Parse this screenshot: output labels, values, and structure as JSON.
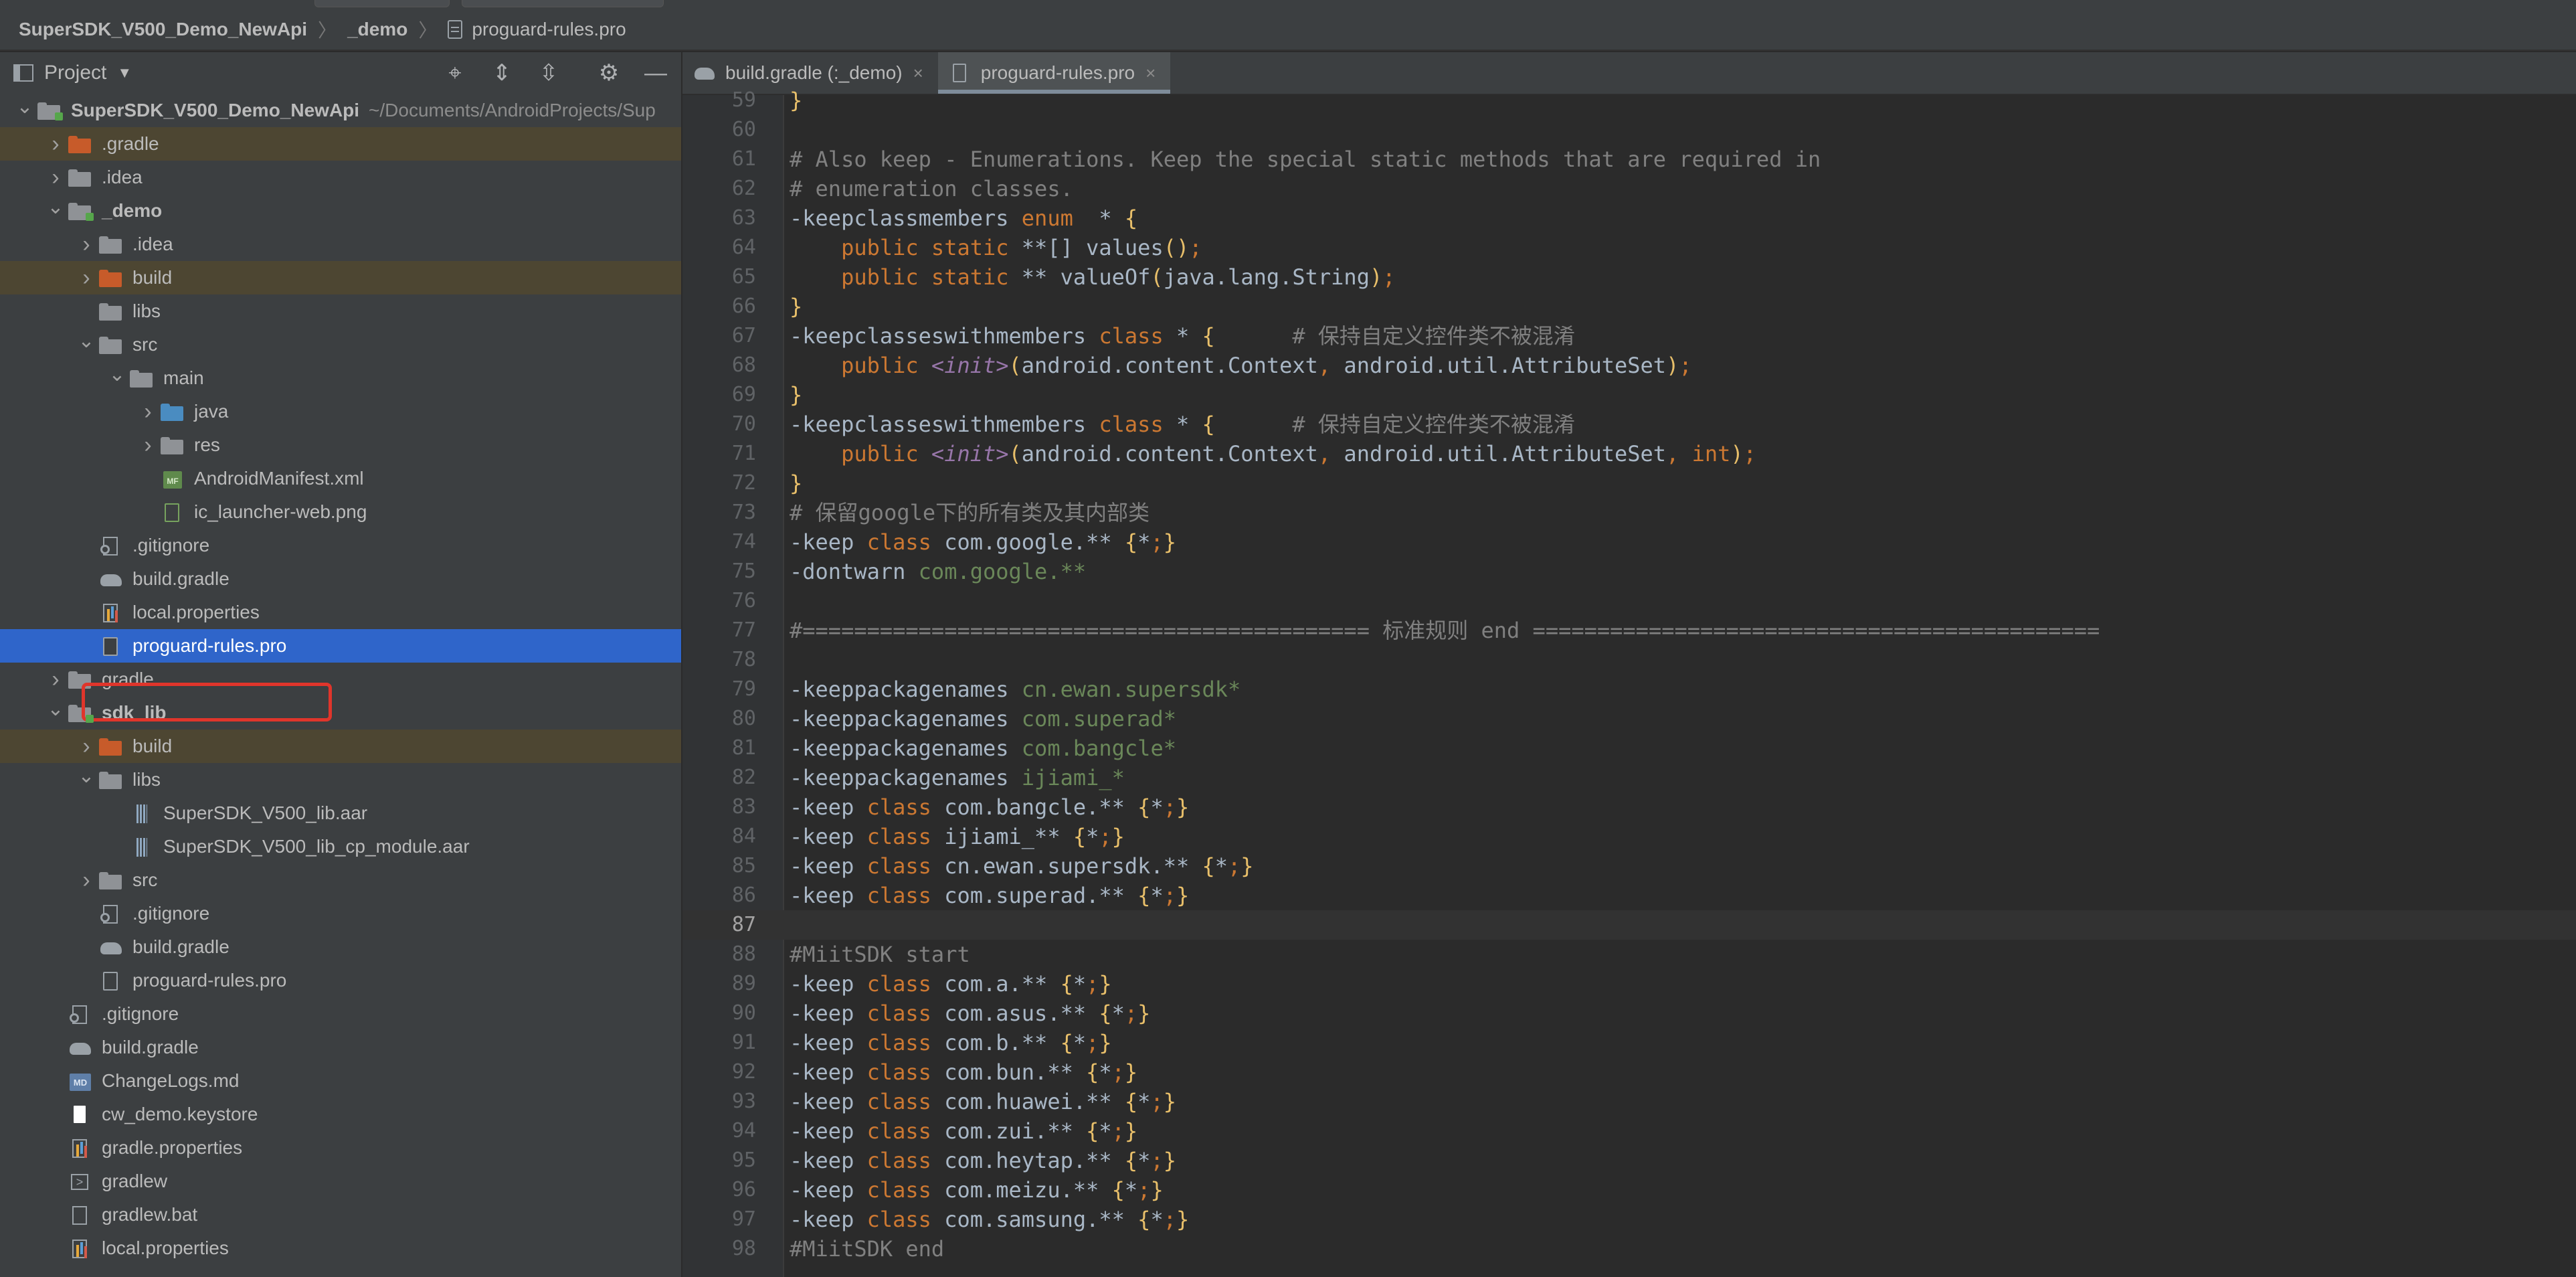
{
  "breadcrumb": {
    "project": "SuperSDK_V500_Demo_NewApi",
    "module": "_demo",
    "file": "proguard-rules.pro"
  },
  "project_panel": {
    "title": "Project",
    "tool_icons": [
      "crosshair-icon",
      "expand-all-icon",
      "collapse-all-icon",
      "gear-icon",
      "minimize-icon"
    ],
    "root_path": "~/Documents/AndroidProjects/Sup",
    "tree": [
      {
        "label": "SuperSDK_V500_Demo_NewApi",
        "depth": 0,
        "arrow": "down",
        "icon": "module",
        "bold": true
      },
      {
        "label": ".gradle",
        "depth": 1,
        "arrow": "right",
        "icon": "orange",
        "excluded": true
      },
      {
        "label": ".idea",
        "depth": 1,
        "arrow": "right",
        "icon": "grey"
      },
      {
        "label": "_demo",
        "depth": 1,
        "arrow": "down",
        "icon": "module",
        "bold": true
      },
      {
        "label": ".idea",
        "depth": 2,
        "arrow": "right",
        "icon": "grey"
      },
      {
        "label": "build",
        "depth": 2,
        "arrow": "right",
        "icon": "orange",
        "excluded": true
      },
      {
        "label": "libs",
        "depth": 2,
        "arrow": "",
        "icon": "grey"
      },
      {
        "label": "src",
        "depth": 2,
        "arrow": "down",
        "icon": "grey"
      },
      {
        "label": "main",
        "depth": 3,
        "arrow": "down",
        "icon": "grey"
      },
      {
        "label": "java",
        "depth": 4,
        "arrow": "right",
        "icon": "blue"
      },
      {
        "label": "res",
        "depth": 4,
        "arrow": "right",
        "icon": "grey"
      },
      {
        "label": "AndroidManifest.xml",
        "depth": 4,
        "arrow": "",
        "icon": "xml"
      },
      {
        "label": "ic_launcher-web.png",
        "depth": 4,
        "arrow": "",
        "icon": "img"
      },
      {
        "label": ".gitignore",
        "depth": 2,
        "arrow": "",
        "icon": "gitignore"
      },
      {
        "label": "build.gradle",
        "depth": 2,
        "arrow": "",
        "icon": "gradle"
      },
      {
        "label": "local.properties",
        "depth": 2,
        "arrow": "",
        "icon": "props"
      },
      {
        "label": "proguard-rules.pro",
        "depth": 2,
        "arrow": "",
        "icon": "file",
        "selected": true
      },
      {
        "label": "gradle",
        "depth": 1,
        "arrow": "right",
        "icon": "grey"
      },
      {
        "label": "sdk_lib",
        "depth": 1,
        "arrow": "down",
        "icon": "module",
        "bold": true
      },
      {
        "label": "build",
        "depth": 2,
        "arrow": "right",
        "icon": "orange",
        "excluded": true
      },
      {
        "label": "libs",
        "depth": 2,
        "arrow": "down",
        "icon": "grey"
      },
      {
        "label": "SuperSDK_V500_lib.aar",
        "depth": 3,
        "arrow": "",
        "icon": "aar"
      },
      {
        "label": "SuperSDK_V500_lib_cp_module.aar",
        "depth": 3,
        "arrow": "",
        "icon": "aar"
      },
      {
        "label": "src",
        "depth": 2,
        "arrow": "right",
        "icon": "grey"
      },
      {
        "label": ".gitignore",
        "depth": 2,
        "arrow": "",
        "icon": "gitignore"
      },
      {
        "label": "build.gradle",
        "depth": 2,
        "arrow": "",
        "icon": "gradle"
      },
      {
        "label": "proguard-rules.pro",
        "depth": 2,
        "arrow": "",
        "icon": "file"
      },
      {
        "label": ".gitignore",
        "depth": 1,
        "arrow": "",
        "icon": "gitignore"
      },
      {
        "label": "build.gradle",
        "depth": 1,
        "arrow": "",
        "icon": "gradle"
      },
      {
        "label": "ChangeLogs.md",
        "depth": 1,
        "arrow": "",
        "icon": "md"
      },
      {
        "label": "cw_demo.keystore",
        "depth": 1,
        "arrow": "",
        "icon": "keystore"
      },
      {
        "label": "gradle.properties",
        "depth": 1,
        "arrow": "",
        "icon": "props"
      },
      {
        "label": "gradlew",
        "depth": 1,
        "arrow": "",
        "icon": "term"
      },
      {
        "label": "gradlew.bat",
        "depth": 1,
        "arrow": "",
        "icon": "bat"
      },
      {
        "label": "local.properties",
        "depth": 1,
        "arrow": "",
        "icon": "props"
      }
    ]
  },
  "tabs": [
    {
      "label": "build.gradle (:_demo)",
      "icon": "gradle",
      "active": false
    },
    {
      "label": "proguard-rules.pro",
      "icon": "file",
      "active": true
    }
  ],
  "editor": {
    "current_line": 87,
    "lines": [
      {
        "n": "59",
        "tokens": [
          [
            "br",
            "}"
          ]
        ]
      },
      {
        "n": "60",
        "tokens": []
      },
      {
        "n": "61",
        "tokens": [
          [
            "cm",
            "# Also keep - Enumerations. Keep the special static methods that are required in"
          ]
        ]
      },
      {
        "n": "62",
        "tokens": [
          [
            "cm",
            "# enumeration classes."
          ]
        ]
      },
      {
        "n": "63",
        "tokens": [
          [
            "tx",
            "-keepclassmembers "
          ],
          [
            "kw",
            "enum"
          ],
          [
            "tx",
            "  * "
          ],
          [
            "br",
            "{"
          ]
        ]
      },
      {
        "n": "64",
        "tokens": [
          [
            "tx",
            "    "
          ],
          [
            "kw",
            "public static"
          ],
          [
            "tx",
            " **[] values"
          ],
          [
            "br",
            "()"
          ],
          [
            "kw",
            ";"
          ]
        ]
      },
      {
        "n": "65",
        "tokens": [
          [
            "tx",
            "    "
          ],
          [
            "kw",
            "public static"
          ],
          [
            "tx",
            " ** valueOf"
          ],
          [
            "br",
            "("
          ],
          [
            "tx",
            "java.lang.String"
          ],
          [
            "br",
            ")"
          ],
          [
            "kw",
            ";"
          ]
        ]
      },
      {
        "n": "66",
        "tokens": [
          [
            "br",
            "}"
          ]
        ]
      },
      {
        "n": "67",
        "tokens": [
          [
            "tx",
            "-keepclasseswithmembers "
          ],
          [
            "kw",
            "class"
          ],
          [
            "tx",
            " * "
          ],
          [
            "br",
            "{"
          ],
          [
            "cm",
            "      # 保持自定义控件类不被混淆"
          ]
        ]
      },
      {
        "n": "68",
        "tokens": [
          [
            "tx",
            "    "
          ],
          [
            "kw",
            "public"
          ],
          [
            "tx",
            " "
          ],
          [
            "ang",
            "<init>"
          ],
          [
            "br",
            "("
          ],
          [
            "tx",
            "android.content.Context"
          ],
          [
            "kw",
            ","
          ],
          [
            "tx",
            " android.util.AttributeSet"
          ],
          [
            "br",
            ")"
          ],
          [
            "kw",
            ";"
          ]
        ]
      },
      {
        "n": "69",
        "tokens": [
          [
            "br",
            "}"
          ]
        ]
      },
      {
        "n": "70",
        "tokens": [
          [
            "tx",
            "-keepclasseswithmembers "
          ],
          [
            "kw",
            "class"
          ],
          [
            "tx",
            " * "
          ],
          [
            "br",
            "{"
          ],
          [
            "cm",
            "      # 保持自定义控件类不被混淆"
          ]
        ]
      },
      {
        "n": "71",
        "tokens": [
          [
            "tx",
            "    "
          ],
          [
            "kw",
            "public"
          ],
          [
            "tx",
            " "
          ],
          [
            "ang",
            "<init>"
          ],
          [
            "br",
            "("
          ],
          [
            "tx",
            "android.content.Context"
          ],
          [
            "kw",
            ","
          ],
          [
            "tx",
            " android.util.AttributeSet"
          ],
          [
            "kw",
            ", int"
          ],
          [
            "br",
            ")"
          ],
          [
            "kw",
            ";"
          ]
        ]
      },
      {
        "n": "72",
        "tokens": [
          [
            "br",
            "}"
          ]
        ]
      },
      {
        "n": "73",
        "tokens": [
          [
            "cm",
            "# 保留google下的所有类及其内部类"
          ]
        ]
      },
      {
        "n": "74",
        "tokens": [
          [
            "tx",
            "-keep "
          ],
          [
            "kw",
            "class"
          ],
          [
            "tx",
            " com.google.** "
          ],
          [
            "br",
            "{"
          ],
          [
            "tx",
            "*"
          ],
          [
            "kw",
            ";"
          ],
          [
            "br",
            "}"
          ]
        ]
      },
      {
        "n": "75",
        "tokens": [
          [
            "tx",
            "-dontwarn "
          ],
          [
            "str",
            "com.google.**"
          ]
        ]
      },
      {
        "n": "76",
        "tokens": []
      },
      {
        "n": "77",
        "tokens": [
          [
            "cm",
            "#============================================ 标准规则 end ============================================"
          ]
        ]
      },
      {
        "n": "78",
        "tokens": []
      },
      {
        "n": "79",
        "tokens": [
          [
            "tx",
            "-keeppackagenames "
          ],
          [
            "str",
            "cn.ewan.supersdk*"
          ]
        ]
      },
      {
        "n": "80",
        "tokens": [
          [
            "tx",
            "-keeppackagenames "
          ],
          [
            "str",
            "com.superad*"
          ]
        ]
      },
      {
        "n": "81",
        "tokens": [
          [
            "tx",
            "-keeppackagenames "
          ],
          [
            "str",
            "com.bangcle*"
          ]
        ]
      },
      {
        "n": "82",
        "tokens": [
          [
            "tx",
            "-keeppackagenames "
          ],
          [
            "str",
            "ijiami_*"
          ]
        ]
      },
      {
        "n": "83",
        "tokens": [
          [
            "tx",
            "-keep "
          ],
          [
            "kw",
            "class"
          ],
          [
            "tx",
            " com.bangcle.** "
          ],
          [
            "br",
            "{"
          ],
          [
            "tx",
            "*"
          ],
          [
            "kw",
            ";"
          ],
          [
            "br",
            "}"
          ]
        ]
      },
      {
        "n": "84",
        "tokens": [
          [
            "tx",
            "-keep "
          ],
          [
            "kw",
            "class"
          ],
          [
            "tx",
            " ijiami_** "
          ],
          [
            "br",
            "{"
          ],
          [
            "tx",
            "*"
          ],
          [
            "kw",
            ";"
          ],
          [
            "br",
            "}"
          ]
        ]
      },
      {
        "n": "85",
        "tokens": [
          [
            "tx",
            "-keep "
          ],
          [
            "kw",
            "class"
          ],
          [
            "tx",
            " cn.ewan.supersdk.** "
          ],
          [
            "br",
            "{"
          ],
          [
            "tx",
            "*"
          ],
          [
            "kw",
            ";"
          ],
          [
            "br",
            "}"
          ]
        ]
      },
      {
        "n": "86",
        "tokens": [
          [
            "tx",
            "-keep "
          ],
          [
            "kw",
            "class"
          ],
          [
            "tx",
            " com.superad.** "
          ],
          [
            "br",
            "{"
          ],
          [
            "tx",
            "*"
          ],
          [
            "kw",
            ";"
          ],
          [
            "br",
            "}"
          ]
        ]
      },
      {
        "n": "87",
        "tokens": []
      },
      {
        "n": "88",
        "tokens": [
          [
            "cm",
            "#MiitSDK start"
          ]
        ]
      },
      {
        "n": "89",
        "tokens": [
          [
            "tx",
            "-keep "
          ],
          [
            "kw",
            "class"
          ],
          [
            "tx",
            " com.a.** "
          ],
          [
            "br",
            "{"
          ],
          [
            "tx",
            "*"
          ],
          [
            "kw",
            ";"
          ],
          [
            "br",
            "}"
          ]
        ]
      },
      {
        "n": "90",
        "tokens": [
          [
            "tx",
            "-keep "
          ],
          [
            "kw",
            "class"
          ],
          [
            "tx",
            " com.asus.** "
          ],
          [
            "br",
            "{"
          ],
          [
            "tx",
            "*"
          ],
          [
            "kw",
            ";"
          ],
          [
            "br",
            "}"
          ]
        ]
      },
      {
        "n": "91",
        "tokens": [
          [
            "tx",
            "-keep "
          ],
          [
            "kw",
            "class"
          ],
          [
            "tx",
            " com.b.** "
          ],
          [
            "br",
            "{"
          ],
          [
            "tx",
            "*"
          ],
          [
            "kw",
            ";"
          ],
          [
            "br",
            "}"
          ]
        ]
      },
      {
        "n": "92",
        "tokens": [
          [
            "tx",
            "-keep "
          ],
          [
            "kw",
            "class"
          ],
          [
            "tx",
            " com.bun.** "
          ],
          [
            "br",
            "{"
          ],
          [
            "tx",
            "*"
          ],
          [
            "kw",
            ";"
          ],
          [
            "br",
            "}"
          ]
        ]
      },
      {
        "n": "93",
        "tokens": [
          [
            "tx",
            "-keep "
          ],
          [
            "kw",
            "class"
          ],
          [
            "tx",
            " com.huawei.** "
          ],
          [
            "br",
            "{"
          ],
          [
            "tx",
            "*"
          ],
          [
            "kw",
            ";"
          ],
          [
            "br",
            "}"
          ]
        ]
      },
      {
        "n": "94",
        "tokens": [
          [
            "tx",
            "-keep "
          ],
          [
            "kw",
            "class"
          ],
          [
            "tx",
            " com.zui.** "
          ],
          [
            "br",
            "{"
          ],
          [
            "tx",
            "*"
          ],
          [
            "kw",
            ";"
          ],
          [
            "br",
            "}"
          ]
        ]
      },
      {
        "n": "95",
        "tokens": [
          [
            "tx",
            "-keep "
          ],
          [
            "kw",
            "class"
          ],
          [
            "tx",
            " com.heytap.** "
          ],
          [
            "br",
            "{"
          ],
          [
            "tx",
            "*"
          ],
          [
            "kw",
            ";"
          ],
          [
            "br",
            "}"
          ]
        ]
      },
      {
        "n": "96",
        "tokens": [
          [
            "tx",
            "-keep "
          ],
          [
            "kw",
            "class"
          ],
          [
            "tx",
            " com.meizu.** "
          ],
          [
            "br",
            "{"
          ],
          [
            "tx",
            "*"
          ],
          [
            "kw",
            ";"
          ],
          [
            "br",
            "}"
          ]
        ]
      },
      {
        "n": "97",
        "tokens": [
          [
            "tx",
            "-keep "
          ],
          [
            "kw",
            "class"
          ],
          [
            "tx",
            " com.samsung.** "
          ],
          [
            "br",
            "{"
          ],
          [
            "tx",
            "*"
          ],
          [
            "kw",
            ";"
          ],
          [
            "br",
            "}"
          ]
        ]
      },
      {
        "n": "98",
        "tokens": [
          [
            "cm",
            "#MiitSDK end"
          ]
        ]
      }
    ]
  }
}
